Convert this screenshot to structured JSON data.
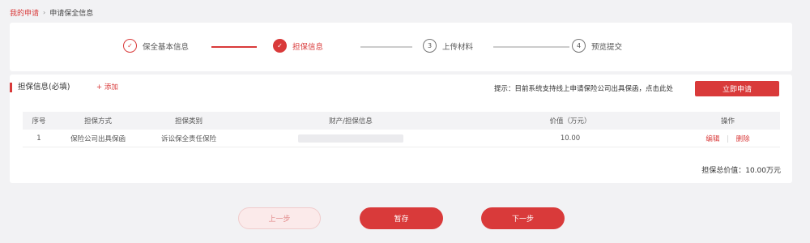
{
  "breadcrumb": {
    "root": "我的申请",
    "separator": "›",
    "current": "申请保全信息"
  },
  "steps": [
    {
      "index": "✓",
      "label": "保全基本信息",
      "state": "done"
    },
    {
      "index": "✓",
      "label": "担保信息",
      "state": "active"
    },
    {
      "index": "3",
      "label": "上传材料",
      "state": "todo"
    },
    {
      "index": "4",
      "label": "预览提交",
      "state": "todo"
    }
  ],
  "section": {
    "title": "担保信息(必填)",
    "add_label": "+ 添加",
    "hint": "提示：目前系统支持线上申请保险公司出具保函，点击此处",
    "apply_button": "立即申请"
  },
  "table": {
    "headers": [
      "序号",
      "担保方式",
      "担保类别",
      "财产/担保信息",
      "价值（万元）",
      "操作"
    ],
    "rows": [
      {
        "index": "1",
        "mode": "保险公司出具保函",
        "type": "诉讼保全责任保险",
        "info": "",
        "value": "10.00",
        "edit": "编辑",
        "delete": "删除"
      }
    ]
  },
  "total": "担保总价值：10.00万元",
  "footer": {
    "prev": "上一步",
    "save": "暂存",
    "next": "下一步"
  },
  "colors": {
    "accent": "#d93a3a",
    "background": "#f2f2f4"
  }
}
